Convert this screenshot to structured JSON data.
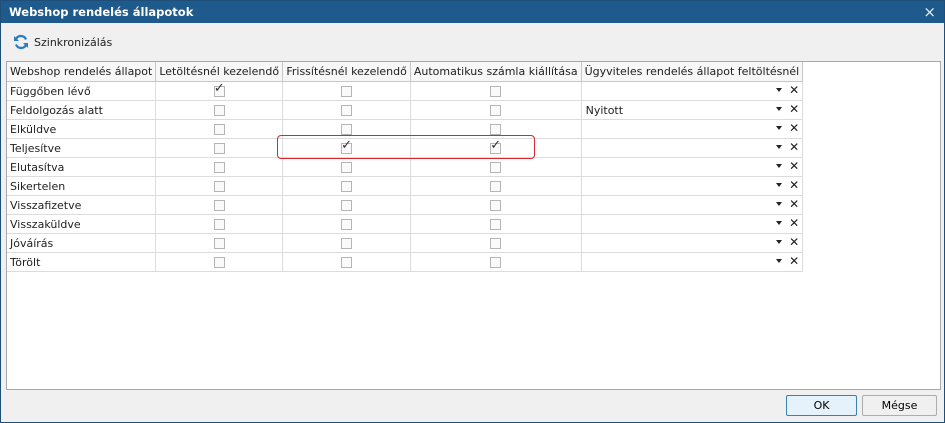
{
  "window": {
    "title": "Webshop rendelés állapotok"
  },
  "toolbar": {
    "sync_label": "Szinkronizálás"
  },
  "grid": {
    "columns": [
      "Webshop rendelés állapot",
      "Letöltésnél kezelendő",
      "Frissítésnél kezelendő",
      "Automatikus számla kiállítása",
      "Ügyviteles rendelés állapot feltöltésnél"
    ],
    "rows": [
      {
        "name": "Függőben lévő",
        "download": true,
        "refresh": false,
        "invoice": false,
        "status": ""
      },
      {
        "name": "Feldolgozás alatt",
        "download": false,
        "refresh": false,
        "invoice": false,
        "status": "Nyitott"
      },
      {
        "name": "Elküldve",
        "download": false,
        "refresh": false,
        "invoice": false,
        "status": ""
      },
      {
        "name": "Teljesítve",
        "download": false,
        "refresh": true,
        "invoice": true,
        "status": ""
      },
      {
        "name": "Elutasítva",
        "download": false,
        "refresh": false,
        "invoice": false,
        "status": ""
      },
      {
        "name": "Sikertelen",
        "download": false,
        "refresh": false,
        "invoice": false,
        "status": ""
      },
      {
        "name": "Visszafizetve",
        "download": false,
        "refresh": false,
        "invoice": false,
        "status": ""
      },
      {
        "name": "Visszaküldve",
        "download": false,
        "refresh": false,
        "invoice": false,
        "status": ""
      },
      {
        "name": "Jóváírás",
        "download": false,
        "refresh": false,
        "invoice": false,
        "status": ""
      },
      {
        "name": "Törölt",
        "download": false,
        "refresh": false,
        "invoice": false,
        "status": ""
      }
    ]
  },
  "buttons": {
    "ok": "OK",
    "cancel": "Mégse"
  },
  "colors": {
    "titlebar": "#1e5a8c",
    "highlight": "#d8262f"
  }
}
